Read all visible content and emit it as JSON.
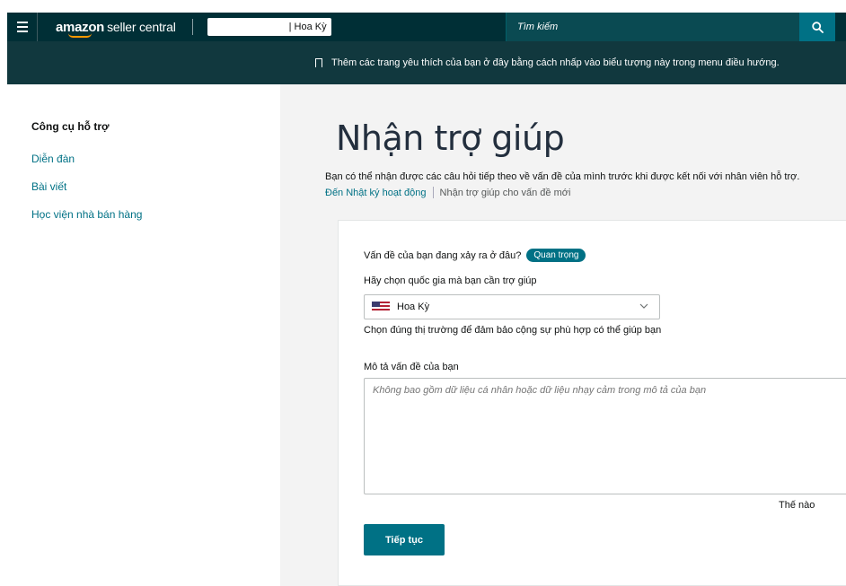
{
  "topbar": {
    "menu_icon": "hamburger-menu-icon",
    "logo_amazon": "amazon",
    "logo_product": "seller central",
    "marketplace_value": "| Hoa Kỳ",
    "search_placeholder": "Tìm kiếm",
    "search_icon": "search-icon"
  },
  "banner": {
    "bookmark_icon": "bookmark-icon",
    "text": "Thêm các trang yêu thích của bạn ở đây bằng cách nhấp vào biểu tượng này trong menu điều hướng."
  },
  "sidebar": {
    "heading": "Công cụ hỗ trợ",
    "links": [
      "Diễn đàn",
      "Bài viết",
      "Học viện nhà bán hàng"
    ]
  },
  "main": {
    "title": "Nhận trợ giúp",
    "subtitle": "Bạn có thể nhận được các câu hỏi tiếp theo về vấn đề của mình trước khi được kết nối với nhân viên hỗ trợ.",
    "link_activity": "Đến Nhật ký hoạt động",
    "link_new_issue": "Nhận trợ giúp cho vấn đề mới"
  },
  "form": {
    "location_question": "Vấn đề của bạn đang xảy ra ở đâu?",
    "important_badge": "Quan trọng",
    "country_question": "Hãy chọn quốc gia mà bạn cần trợ giúp",
    "country_value": "Hoa Kỳ",
    "country_hint": "Chọn đúng thị trường để đảm bảo cộng sự phù hợp có thể giúp bạn",
    "description_label": "Mô tả vấn đề của bạn",
    "description_placeholder": "Không bao gồm dữ liệu cá nhân hoặc dữ liệu nhạy cảm trong mô tả của bạn",
    "description_value": "",
    "howto_text": "Thế nào",
    "continue_label": "Tiếp tục"
  },
  "colors": {
    "topbar": "#002f36",
    "banner": "#11383e",
    "accent": "#007185"
  }
}
